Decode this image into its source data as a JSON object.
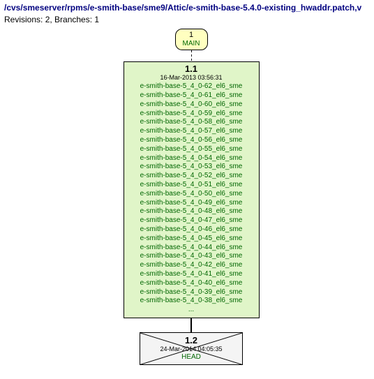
{
  "header": {
    "path": "/cvs/smeserver/rpms/e-smith-base/sme9/Attic/e-smith-base-5.4.0-existing_hwaddr.patch,v",
    "meta": "Revisions: 2, Branches: 1"
  },
  "main_tag": {
    "num": "1",
    "name": "MAIN"
  },
  "rev1": {
    "num": "1.1",
    "date": "16-Mar-2013 03:56:31",
    "tags": [
      "e-smith-base-5_4_0-62_el6_sme",
      "e-smith-base-5_4_0-61_el6_sme",
      "e-smith-base-5_4_0-60_el6_sme",
      "e-smith-base-5_4_0-59_el6_sme",
      "e-smith-base-5_4_0-58_el6_sme",
      "e-smith-base-5_4_0-57_el6_sme",
      "e-smith-base-5_4_0-56_el6_sme",
      "e-smith-base-5_4_0-55_el6_sme",
      "e-smith-base-5_4_0-54_el6_sme",
      "e-smith-base-5_4_0-53_el6_sme",
      "e-smith-base-5_4_0-52_el6_sme",
      "e-smith-base-5_4_0-51_el6_sme",
      "e-smith-base-5_4_0-50_el6_sme",
      "e-smith-base-5_4_0-49_el6_sme",
      "e-smith-base-5_4_0-48_el6_sme",
      "e-smith-base-5_4_0-47_el6_sme",
      "e-smith-base-5_4_0-46_el6_sme",
      "e-smith-base-5_4_0-45_el6_sme",
      "e-smith-base-5_4_0-44_el6_sme",
      "e-smith-base-5_4_0-43_el6_sme",
      "e-smith-base-5_4_0-42_el6_sme",
      "e-smith-base-5_4_0-41_el6_sme",
      "e-smith-base-5_4_0-40_el6_sme",
      "e-smith-base-5_4_0-39_el6_sme",
      "e-smith-base-5_4_0-38_el6_sme"
    ],
    "ellipsis": "..."
  },
  "rev2": {
    "num": "1.2",
    "date": "24-Mar-2014 04:05:35",
    "head": "HEAD"
  }
}
